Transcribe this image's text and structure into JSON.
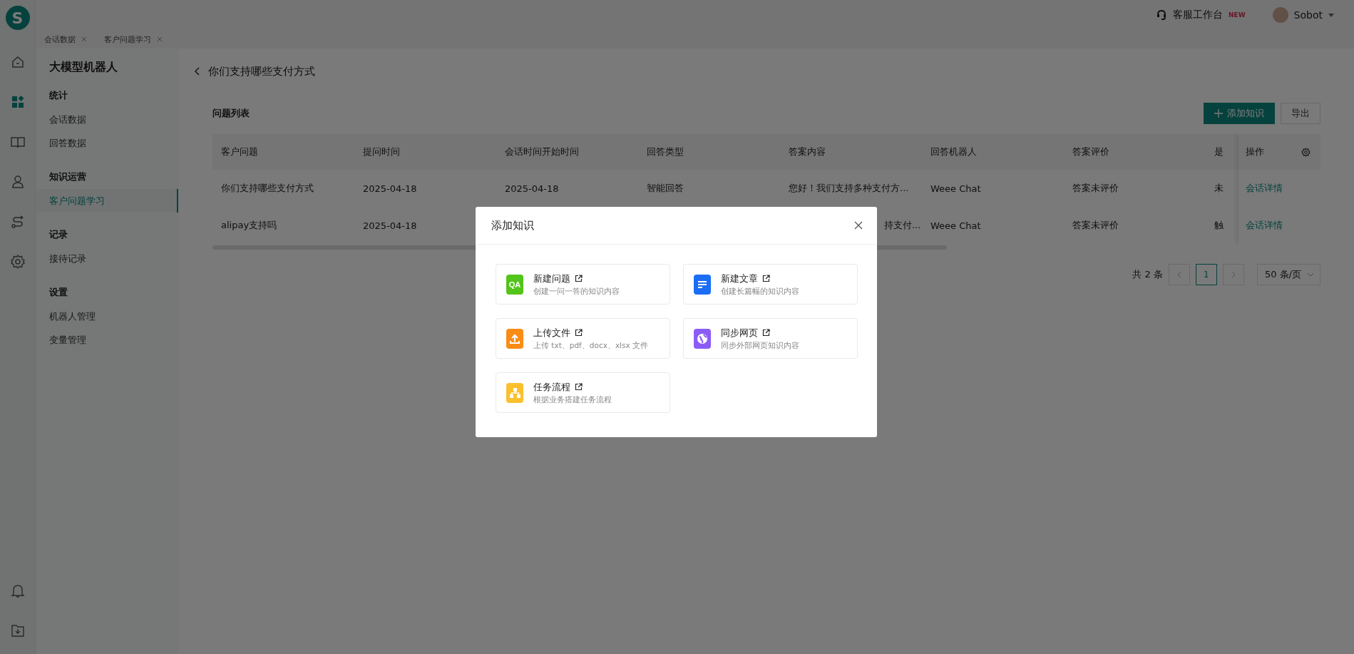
{
  "logo": {
    "letter": "S"
  },
  "rail": {
    "top": [
      {
        "kind": "home",
        "selected": false
      },
      {
        "kind": "grid",
        "selected": true
      },
      {
        "kind": "book",
        "selected": false
      },
      {
        "kind": "person",
        "selected": false
      },
      {
        "kind": "flow",
        "selected": false
      },
      {
        "kind": "gear",
        "selected": false
      }
    ],
    "bottom": [
      {
        "kind": "bell",
        "selected": false
      },
      {
        "kind": "download",
        "selected": false
      }
    ]
  },
  "topbar": {
    "workbench": {
      "label": "客服工作台",
      "badge": "NEW"
    },
    "user": {
      "name": "Sobot"
    }
  },
  "tabs": [
    {
      "label": "会话数据"
    },
    {
      "label": "客户问题学习"
    }
  ],
  "sidebar": {
    "title": "大模型机器人",
    "groups": [
      {
        "heading": "统计",
        "items": [
          {
            "label": "会话数据",
            "selected": false
          },
          {
            "label": "回答数据",
            "selected": false
          }
        ]
      },
      {
        "heading": "知识运营",
        "items": [
          {
            "label": "客户问题学习",
            "selected": true
          }
        ]
      },
      {
        "heading": "记录",
        "items": [
          {
            "label": "接待记录",
            "selected": false
          }
        ]
      },
      {
        "heading": "设置",
        "items": [
          {
            "label": "机器人管理",
            "selected": false
          },
          {
            "label": "变量管理",
            "selected": false
          }
        ]
      }
    ]
  },
  "page": {
    "title": "你们支持哪些支付方式"
  },
  "list": {
    "title": "问题列表",
    "buttons": [
      {
        "label": "添加知识",
        "kind": "primary"
      },
      {
        "label": "导出",
        "kind": "default"
      }
    ]
  },
  "table": {
    "columns": [
      "客户问题",
      "提问时间",
      "会话时间开始时间",
      "回答类型",
      "答案内容",
      "回答机器人",
      "答案评价",
      "是"
    ],
    "action_column": "操作",
    "rows": [
      {
        "cells": [
          "你们支持哪些支付方式",
          "2025-04-18",
          "2025-04-18",
          "智能回答",
          "您好！我们支持多种支付方...",
          "Weee Chat",
          "答案未评价",
          "未"
        ],
        "action": "会话详情"
      },
      {
        "cells": [
          "alipay支持吗",
          "2025-04-18",
          null,
          null,
          "持支付...",
          "Weee Chat",
          "答案未评价",
          "触"
        ],
        "action": "会话详情"
      }
    ]
  },
  "pagination": {
    "total": "共 2 条",
    "pages": [
      {
        "label": "1",
        "selected": true
      }
    ],
    "page_size": "50 条/页"
  },
  "dialog": {
    "title": "添加知识",
    "options": [
      {
        "title": "新建问题",
        "description": "创建一问一答的知识内容",
        "kind": "qa",
        "color": "#52c41a",
        "icon_text": "QA"
      },
      {
        "title": "新建文章",
        "description": "创建长篇幅的知识内容",
        "kind": "article",
        "color": "#1a6ef5"
      },
      {
        "title": "上传文件",
        "description": "上传 txt、pdf、docx、xlsx 文件",
        "kind": "upload",
        "color": "#fa8c16"
      },
      {
        "title": "同步网页",
        "description": "同步外部网页知识内容",
        "kind": "web",
        "color": "#8b5cf6"
      },
      {
        "title": "任务流程",
        "description": "根据业务搭建任务流程",
        "kind": "flow",
        "color": "#fbc02d"
      }
    ]
  }
}
